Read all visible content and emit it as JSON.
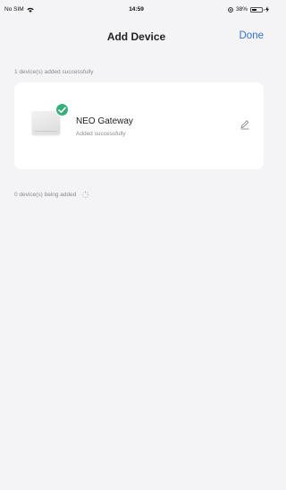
{
  "status_bar": {
    "carrier": "No SIM",
    "time": "14:59",
    "battery": "38%",
    "battery_level": 0.38,
    "icons": [
      "wifi-icon",
      "location-icon",
      "battery-icon",
      "charging-icon"
    ]
  },
  "nav": {
    "title": "Add Device",
    "done_label": "Done",
    "accent_color": "#2f6fe0"
  },
  "added_section": {
    "label": "1 device(s) added successfully",
    "devices": [
      {
        "name": "NEO Gateway",
        "status": "Added successfully",
        "badge_icon": "check-icon",
        "badge_color": "#33b07a",
        "action_icon": "edit-pencil-icon"
      }
    ]
  },
  "adding_section": {
    "label": "0 device(s) being added",
    "icon": "spinner-icon"
  }
}
